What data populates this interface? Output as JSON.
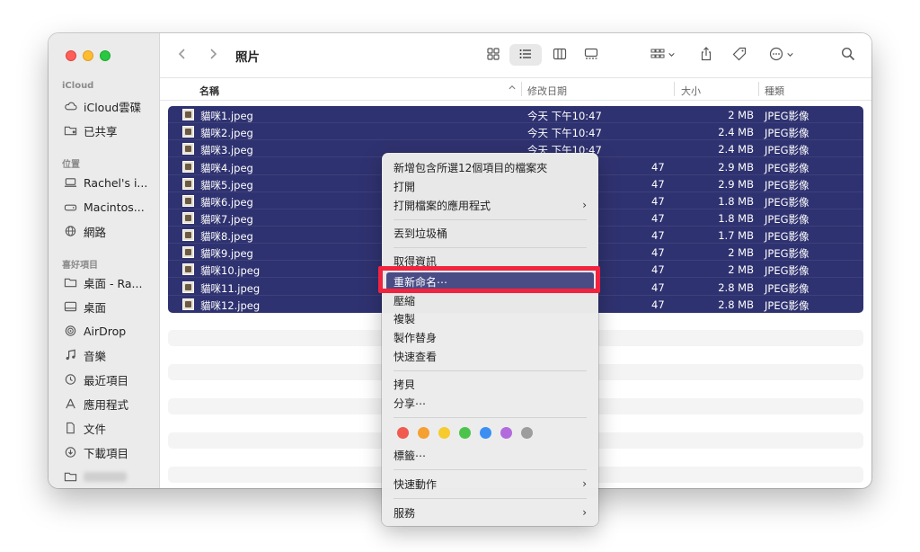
{
  "window": {
    "title": "照片"
  },
  "sidebar": {
    "sections": [
      {
        "label": "iCloud"
      },
      {
        "label": "位置"
      },
      {
        "label": "喜好項目"
      }
    ],
    "items": [
      {
        "label": "iCloud雲碟",
        "icon": "cloud-icon"
      },
      {
        "label": "已共享",
        "icon": "shared-folder-icon"
      },
      {
        "label": "Rachel's i...",
        "icon": "laptop-icon"
      },
      {
        "label": "Macintos...",
        "icon": "disk-icon"
      },
      {
        "label": "網路",
        "icon": "globe-icon"
      },
      {
        "label": "桌面 - Ra...",
        "icon": "folder-icon"
      },
      {
        "label": "桌面",
        "icon": "desktop-icon"
      },
      {
        "label": "AirDrop",
        "icon": "airdrop-icon"
      },
      {
        "label": "音樂",
        "icon": "music-icon"
      },
      {
        "label": "最近項目",
        "icon": "clock-icon"
      },
      {
        "label": "應用程式",
        "icon": "apps-icon"
      },
      {
        "label": "文件",
        "icon": "document-icon"
      },
      {
        "label": "下載項目",
        "icon": "download-icon"
      }
    ]
  },
  "columns": {
    "name": "名稱",
    "date": "修改日期",
    "size": "大小",
    "kind": "種類"
  },
  "files": [
    {
      "name": "貓咪1.jpeg",
      "date": "今天 下午10:47",
      "size": "2 MB",
      "kind": "JPEG影像"
    },
    {
      "name": "貓咪2.jpeg",
      "date": "今天 下午10:47",
      "size": "2.4 MB",
      "kind": "JPEG影像"
    },
    {
      "name": "貓咪3.jpeg",
      "date": "今天 下午10:47",
      "size": "2.4 MB",
      "kind": "JPEG影像"
    },
    {
      "name": "貓咪4.jpeg",
      "date": "47",
      "size": "2.9 MB",
      "kind": "JPEG影像"
    },
    {
      "name": "貓咪5.jpeg",
      "date": "47",
      "size": "2.9 MB",
      "kind": "JPEG影像"
    },
    {
      "name": "貓咪6.jpeg",
      "date": "47",
      "size": "1.8 MB",
      "kind": "JPEG影像"
    },
    {
      "name": "貓咪7.jpeg",
      "date": "47",
      "size": "1.8 MB",
      "kind": "JPEG影像"
    },
    {
      "name": "貓咪8.jpeg",
      "date": "47",
      "size": "1.7 MB",
      "kind": "JPEG影像"
    },
    {
      "name": "貓咪9.jpeg",
      "date": "47",
      "size": "2 MB",
      "kind": "JPEG影像"
    },
    {
      "name": "貓咪10.jpeg",
      "date": "47",
      "size": "2 MB",
      "kind": "JPEG影像"
    },
    {
      "name": "貓咪11.jpeg",
      "date": "47",
      "size": "2.8 MB",
      "kind": "JPEG影像"
    },
    {
      "name": "貓咪12.jpeg",
      "date": "47",
      "size": "2.8 MB",
      "kind": "JPEG影像"
    }
  ],
  "menu": {
    "items": [
      "新增包含所選12個項目的檔案夾",
      "打開",
      "打開檔案的應用程式",
      "丟到垃圾桶",
      "取得資訊",
      "重新命名⋯",
      "壓縮",
      "複製",
      "製作替身",
      "快速查看",
      "拷貝",
      "分享⋯",
      "標籤⋯",
      "快速動作",
      "服務"
    ],
    "chevron": "›",
    "tag_colors": [
      "#f05a4f",
      "#f5a031",
      "#f7ca2e",
      "#4cc44c",
      "#3b8ff3",
      "#b26bdd",
      "#9d9d9d"
    ],
    "highlight_color": "#f2233f"
  }
}
